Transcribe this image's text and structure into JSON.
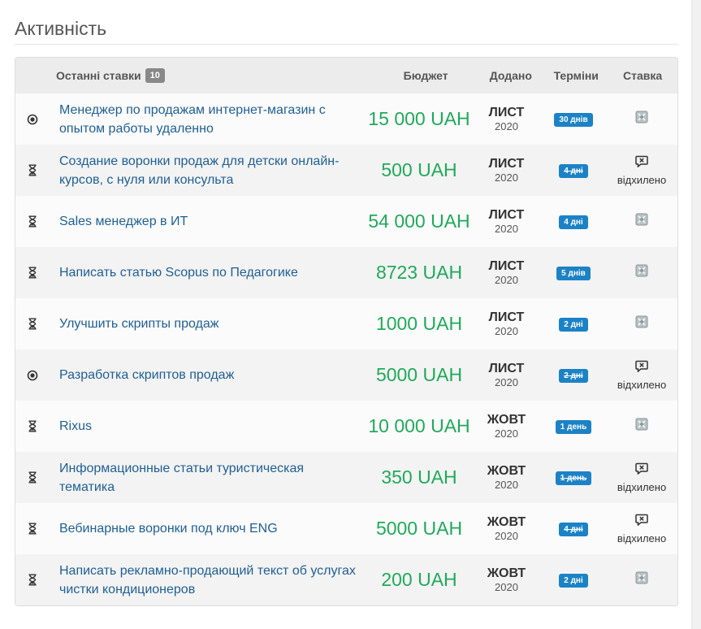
{
  "section": {
    "title": "Активність"
  },
  "table": {
    "headers": {
      "recent_bids": "Останні ставки",
      "count": "10",
      "budget": "Бюджет",
      "added": "Додано",
      "terms": "Терміни",
      "bid": "Ставка"
    },
    "rows": [
      {
        "status_icon": "active-circle-icon",
        "title": "Менеджер по продажам интернет-магазин с опытом работы удаленно",
        "budget": "15 000 UAH",
        "month": "ЛИСТ",
        "year": "2020",
        "term": "30 днів",
        "term_expired": false,
        "bid_icon": "bid-placeholder-icon",
        "bid_status": ""
      },
      {
        "status_icon": "hourglass-icon",
        "title": "Создание воронки продаж для детски онлайн-курсов, с нуля или консульта",
        "budget": "500 UAH",
        "month": "ЛИСТ",
        "year": "2020",
        "term": "4 дні",
        "term_expired": true,
        "bid_icon": "rejected-message-icon",
        "bid_status": "відхилено"
      },
      {
        "status_icon": "hourglass-icon",
        "title": "Sales менеджер в ИТ",
        "budget": "54 000 UAH",
        "month": "ЛИСТ",
        "year": "2020",
        "term": "4 дні",
        "term_expired": false,
        "bid_icon": "bid-placeholder-icon",
        "bid_status": ""
      },
      {
        "status_icon": "hourglass-icon",
        "title": "Написать статью Scopus по Педагогике",
        "budget": "8723 UAH",
        "month": "ЛИСТ",
        "year": "2020",
        "term": "5 днів",
        "term_expired": false,
        "bid_icon": "bid-placeholder-icon",
        "bid_status": ""
      },
      {
        "status_icon": "hourglass-icon",
        "title": "Улучшить скрипты продаж",
        "budget": "1000 UAH",
        "month": "ЛИСТ",
        "year": "2020",
        "term": "2 дні",
        "term_expired": false,
        "bid_icon": "bid-placeholder-icon",
        "bid_status": ""
      },
      {
        "status_icon": "active-circle-icon",
        "title": "Разработка скриптов продаж",
        "budget": "5000 UAH",
        "month": "ЛИСТ",
        "year": "2020",
        "term": "2 дні",
        "term_expired": true,
        "bid_icon": "rejected-message-icon",
        "bid_status": "відхилено"
      },
      {
        "status_icon": "hourglass-icon",
        "title": "Rixus",
        "budget": "10 000 UAH",
        "month": "ЖОВТ",
        "year": "2020",
        "term": "1 день",
        "term_expired": false,
        "bid_icon": "bid-placeholder-icon",
        "bid_status": ""
      },
      {
        "status_icon": "hourglass-icon",
        "title": "Информационные статьи туристическая тематика",
        "budget": "350 UAH",
        "month": "ЖОВТ",
        "year": "2020",
        "term": "1 день",
        "term_expired": true,
        "bid_icon": "rejected-message-icon",
        "bid_status": "відхилено"
      },
      {
        "status_icon": "hourglass-icon",
        "title": "Вебинарные воронки под ключ ENG",
        "budget": "5000 UAH",
        "month": "ЖОВТ",
        "year": "2020",
        "term": "4 дні",
        "term_expired": true,
        "bid_icon": "rejected-message-icon",
        "bid_status": "відхилено"
      },
      {
        "status_icon": "hourglass-icon",
        "title": "Написать рекламно-продающий текст об услугах чистки кондиционеров",
        "budget": "200 UAH",
        "month": "ЖОВТ",
        "year": "2020",
        "term": "2 дні",
        "term_expired": false,
        "bid_icon": "bid-placeholder-icon",
        "bid_status": ""
      }
    ]
  },
  "colors": {
    "link": "#1f5f94",
    "budget": "#1faa5a",
    "term_badge": "#1c82c6",
    "count_badge": "#888888"
  }
}
